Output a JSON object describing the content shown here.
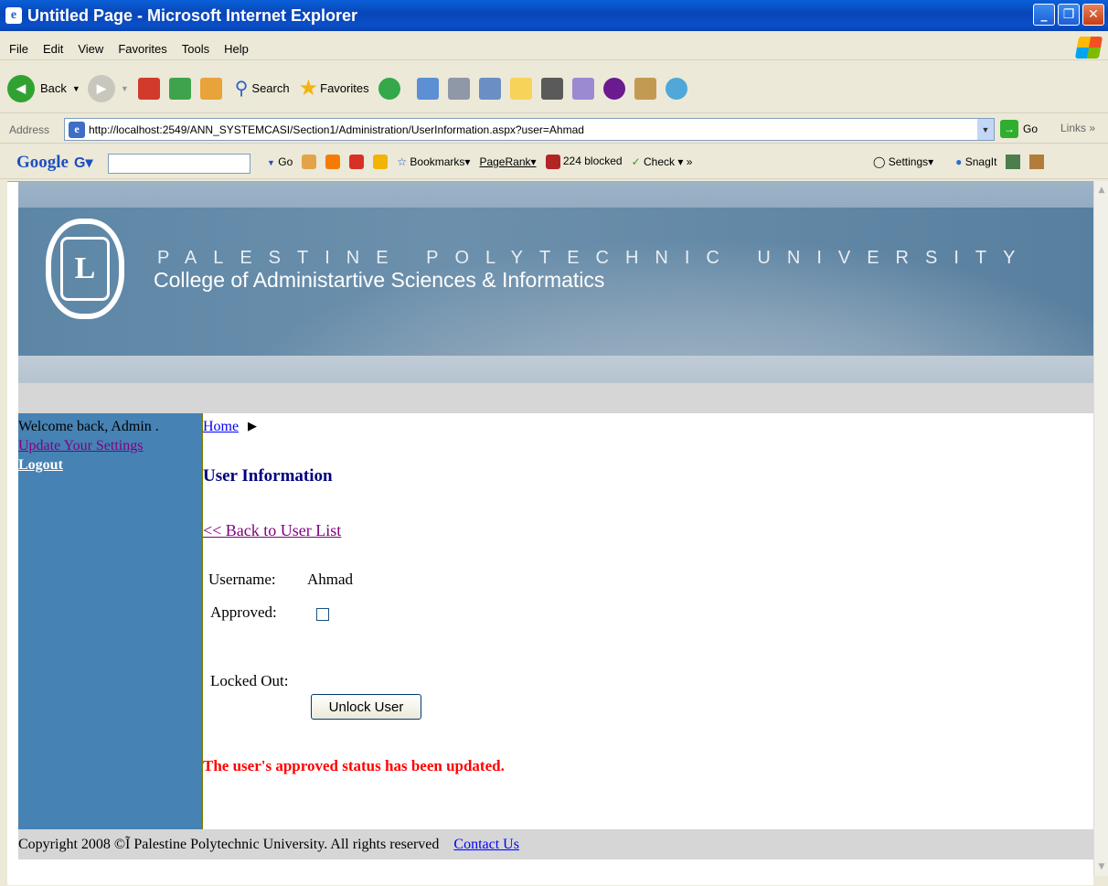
{
  "window": {
    "title": "Untitled Page - Microsoft Internet Explorer",
    "buttons": [
      "_",
      "❐",
      "✕"
    ]
  },
  "menu": [
    "File",
    "Edit",
    "View",
    "Favorites",
    "Tools",
    "Help"
  ],
  "toolbar": {
    "back": "Back",
    "search": "Search",
    "favorites": "Favorites"
  },
  "address": {
    "label": "Address",
    "url": "http://localhost:2549/ANN_SYSTEMCASI/Section1/Administration/UserInformation.aspx?user=Ahmad",
    "go": "Go",
    "links": "Links"
  },
  "google": {
    "logo": "Google",
    "go": "Go",
    "bookmarks": "Bookmarks",
    "pagerank": "PageRank",
    "blocked": "224 blocked",
    "check": "Check",
    "settings": "Settings",
    "snagit": "SnagIt"
  },
  "banner": {
    "line1": "PALESTINE POLYTECHNIC UNIVERSITY",
    "line2": "College of Administartive Sciences & Informatics"
  },
  "sidebar": {
    "welcome": "Welcome back, Admin .",
    "settings": "Update Your Settings",
    "logout": "Logout"
  },
  "main": {
    "breadcrumb": "Home",
    "title": "User Information",
    "back_link": "<< Back to User List",
    "username_label": "Username:",
    "username_value": "Ahmad",
    "approved_label": "Approved:",
    "approved_checked": false,
    "locked_label": "Locked Out:",
    "unlock_button": "Unlock User",
    "status_message": "The user's approved status has been updated."
  },
  "footer": {
    "copyright": "Copyright 2008 ©Ĩ Palestine Polytechnic University. All rights reserved",
    "contact": "Contact Us"
  }
}
